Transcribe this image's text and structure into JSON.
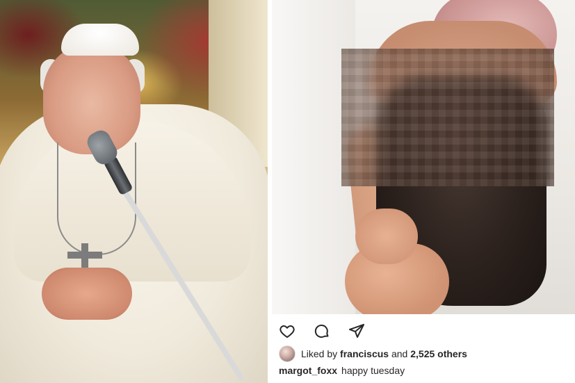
{
  "post": {
    "liked_by_prefix": "Liked by",
    "liked_by_user": "franciscus",
    "liked_by_and": "and",
    "others_count": "2,525 others",
    "caption_user": "margot_foxx",
    "caption_text": "happy tuesday"
  },
  "icons": [
    "heart-icon",
    "comment-icon",
    "share-icon"
  ],
  "colors": {
    "text": "#262626",
    "background": "#ffffff"
  }
}
